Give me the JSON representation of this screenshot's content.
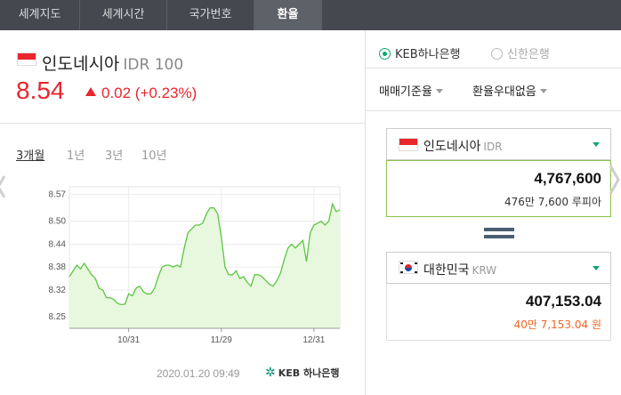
{
  "tabs": [
    {
      "label": "세계지도",
      "active": false
    },
    {
      "label": "세계시간",
      "active": false
    },
    {
      "label": "국가번호",
      "active": false
    },
    {
      "label": "환율",
      "active": true
    }
  ],
  "quote": {
    "country": "인도네시아",
    "code": "IDR 100",
    "price": "8.54",
    "change": "0.02 (+0.23%)",
    "direction": "up"
  },
  "periods": [
    "3개월",
    "1년",
    "3년",
    "10년"
  ],
  "active_period": "3개월",
  "chart_data": {
    "type": "area",
    "x_tick_labels": [
      "10/31",
      "11/29",
      "12/31"
    ],
    "y_tick_labels": [
      "8.57",
      "8.50",
      "8.44",
      "8.38",
      "8.32",
      "8.25"
    ],
    "ylim": [
      8.22,
      8.59
    ],
    "grid": true,
    "values": [
      8.355,
      8.37,
      8.385,
      8.375,
      8.39,
      8.375,
      8.36,
      8.35,
      8.325,
      8.32,
      8.3,
      8.3,
      8.295,
      8.285,
      8.282,
      8.283,
      8.31,
      8.305,
      8.325,
      8.33,
      8.315,
      8.31,
      8.31,
      8.325,
      8.355,
      8.38,
      8.385,
      8.385,
      8.38,
      8.385,
      8.38,
      8.43,
      8.47,
      8.48,
      8.49,
      8.49,
      8.495,
      8.52,
      8.535,
      8.535,
      8.52,
      8.46,
      8.38,
      8.36,
      8.36,
      8.37,
      8.35,
      8.355,
      8.34,
      8.33,
      8.36,
      8.36,
      8.355,
      8.345,
      8.335,
      8.33,
      8.345,
      8.365,
      8.4,
      8.43,
      8.44,
      8.43,
      8.44,
      8.45,
      8.395,
      8.47,
      8.49,
      8.495,
      8.5,
      8.49,
      8.5,
      8.545,
      8.525,
      8.53
    ],
    "color": "#5cc542",
    "fill": "#e7f8de"
  },
  "timestamp": "2020.01.20 09:49",
  "bank_name": "KEB 하나은행",
  "banks": [
    {
      "label": "KEB하나은행",
      "selected": true
    },
    {
      "label": "신한은행",
      "selected": false
    }
  ],
  "rate_type": "매매기준율",
  "discount": "환율우대없음",
  "from": {
    "country": "인도네시아",
    "code": "IDR",
    "amount": "4,767,600",
    "words": "476만 7,600 루피아",
    "words_color": "#333333"
  },
  "to": {
    "country": "대한민국",
    "code": "KRW",
    "amount": "407,153.04",
    "words": "40만 7,153.04 원",
    "words_color": "#f26522"
  }
}
